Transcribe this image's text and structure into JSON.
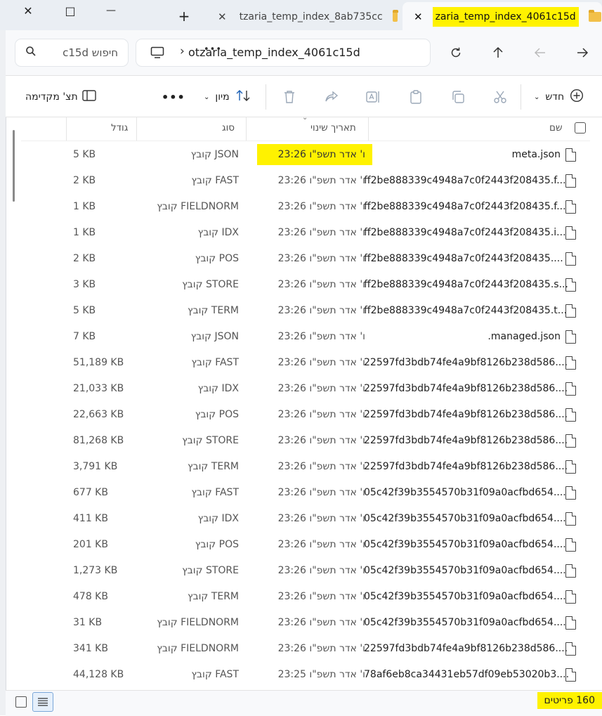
{
  "window": {
    "minimize": "—",
    "maximize": "□",
    "close": "✕"
  },
  "tabs": [
    {
      "title": "tzaria_temp_index_8ab735cc",
      "close": "✕"
    },
    {
      "title": "zaria_temp_index_4061c15d",
      "close": "✕"
    }
  ],
  "new_tab": "+",
  "address": {
    "search_placeholder": "חיפוש c15d",
    "path": "otzaria_temp_index_4061c15d",
    "more": "•••",
    "chevron": "›"
  },
  "toolbar": {
    "new_label": "חדש",
    "sort_label": "מיון",
    "more": "•••",
    "preview_label": "תצ' מקדימה"
  },
  "columns": {
    "name": "שם",
    "date": "תאריך שינוי",
    "type": "סוג",
    "size": "גודל"
  },
  "files": [
    {
      "name": "meta.json",
      "date": "ו' אדר תשפ\"ו 23:26",
      "type": "קובץ JSON",
      "size": "5 KB"
    },
    {
      "name": "ff2be888339c4948a7c0f2443f208435.f...",
      "date": "ו' אדר תשפ\"ו 23:26",
      "type": "קובץ FAST",
      "size": "2 KB"
    },
    {
      "name": "ff2be888339c4948a7c0f2443f208435.f...",
      "date": "ו' אדר תשפ\"ו 23:26",
      "type": "קובץ FIELDNORM",
      "size": "1 KB"
    },
    {
      "name": "ff2be888339c4948a7c0f2443f208435.i...",
      "date": "ו' אדר תשפ\"ו 23:26",
      "type": "קובץ IDX",
      "size": "1 KB"
    },
    {
      "name": "ff2be888339c4948a7c0f2443f208435....",
      "date": "ו' אדר תשפ\"ו 23:26",
      "type": "קובץ POS",
      "size": "2 KB"
    },
    {
      "name": "ff2be888339c4948a7c0f2443f208435.s...",
      "date": "ו' אדר תשפ\"ו 23:26",
      "type": "קובץ STORE",
      "size": "3 KB"
    },
    {
      "name": "ff2be888339c4948a7c0f2443f208435.t...",
      "date": "ו' אדר תשפ\"ו 23:26",
      "type": "קובץ TERM",
      "size": "5 KB"
    },
    {
      "name": ".managed.json",
      "date": "ו' אדר תשפ\"ו 23:26",
      "type": "קובץ JSON",
      "size": "7 KB"
    },
    {
      "name": "22597fd3bdb74fe4a9bf8126b238d586....",
      "date": "ו' אדר תשפ\"ו 23:26",
      "type": "קובץ FAST",
      "size": "51,189 KB"
    },
    {
      "name": "22597fd3bdb74fe4a9bf8126b238d586....",
      "date": "ו' אדר תשפ\"ו 23:26",
      "type": "קובץ IDX",
      "size": "21,033 KB"
    },
    {
      "name": "22597fd3bdb74fe4a9bf8126b238d586....",
      "date": "ו' אדר תשפ\"ו 23:26",
      "type": "קובץ POS",
      "size": "22,663 KB"
    },
    {
      "name": "22597fd3bdb74fe4a9bf8126b238d586....",
      "date": "ו' אדר תשפ\"ו 23:26",
      "type": "קובץ STORE",
      "size": "81,268 KB"
    },
    {
      "name": "22597fd3bdb74fe4a9bf8126b238d586....",
      "date": "ו' אדר תשפ\"ו 23:26",
      "type": "קובץ TERM",
      "size": "3,791 KB"
    },
    {
      "name": "05c42f39b3554570b31f09a0acfbd654....",
      "date": "ו' אדר תשפ\"ו 23:26",
      "type": "קובץ FAST",
      "size": "677 KB"
    },
    {
      "name": "05c42f39b3554570b31f09a0acfbd654....",
      "date": "ו' אדר תשפ\"ו 23:26",
      "type": "קובץ IDX",
      "size": "411 KB"
    },
    {
      "name": "05c42f39b3554570b31f09a0acfbd654....",
      "date": "ו' אדר תשפ\"ו 23:26",
      "type": "קובץ POS",
      "size": "201 KB"
    },
    {
      "name": "05c42f39b3554570b31f09a0acfbd654....",
      "date": "ו' אדר תשפ\"ו 23:26",
      "type": "קובץ STORE",
      "size": "1,273 KB"
    },
    {
      "name": "05c42f39b3554570b31f09a0acfbd654....",
      "date": "ו' אדר תשפ\"ו 23:26",
      "type": "קובץ TERM",
      "size": "478 KB"
    },
    {
      "name": "05c42f39b3554570b31f09a0acfbd654....",
      "date": "ו' אדר תשפ\"ו 23:26",
      "type": "קובץ FIELDNORM",
      "size": "31 KB"
    },
    {
      "name": "22597fd3bdb74fe4a9bf8126b238d586....",
      "date": "ו' אדר תשפ\"ו 23:26",
      "type": "קובץ FIELDNORM",
      "size": "341 KB"
    },
    {
      "name": "78af6eb8ca34431eb57df09eb53020b3....",
      "date": "ו' אדר תשפ\"ו 23:25",
      "type": "קובץ FAST",
      "size": "44,128 KB"
    }
  ],
  "status": {
    "count": "160 פריטים"
  },
  "colors": {
    "highlight": "#fff200",
    "tab_bg": "#eaeef3",
    "accent": "#1a1a1a"
  }
}
